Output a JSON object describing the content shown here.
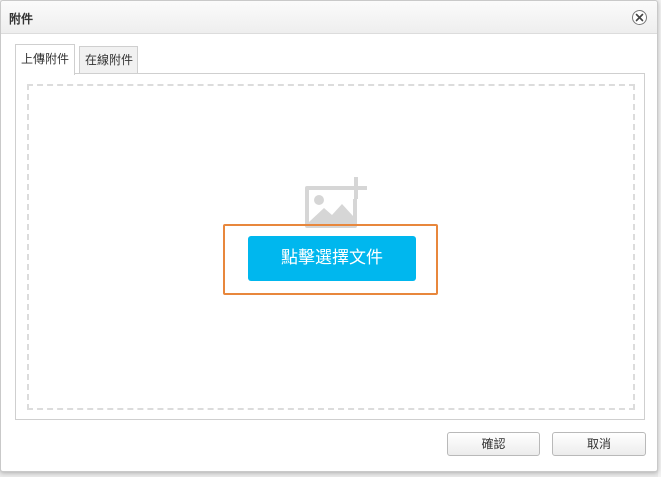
{
  "dialog": {
    "title": "附件",
    "close_icon": "close-icon"
  },
  "tabs": [
    {
      "label": "上傳附件",
      "active": true
    },
    {
      "label": "在線附件",
      "active": false
    }
  ],
  "upload": {
    "placeholder_icon": "image-add-icon",
    "pick_button_label": "點擊選擇文件",
    "accent_color": "#00b7ee",
    "highlight_color": "#e8873c"
  },
  "footer": {
    "ok_label": "確認",
    "cancel_label": "取消"
  }
}
